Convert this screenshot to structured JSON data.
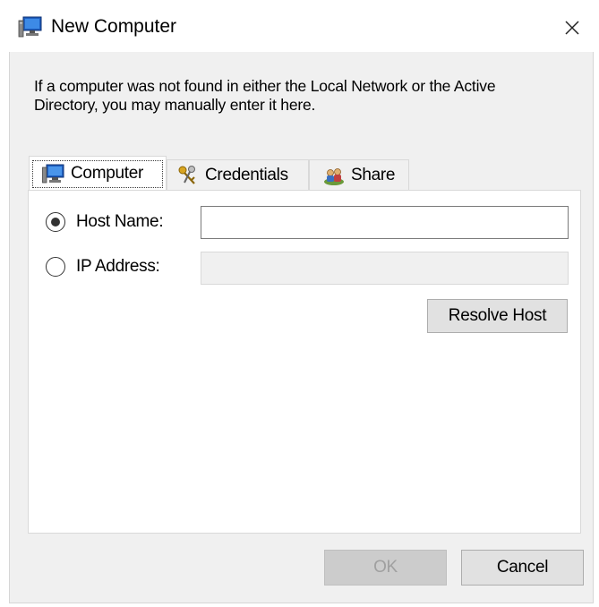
{
  "window": {
    "title": "New Computer",
    "icon": "computer-icon",
    "close_icon": "close-icon"
  },
  "description": "If a computer was not found in either the Local Network or the Active Directory, you may manually enter it here.",
  "tabs": [
    {
      "label": "Computer",
      "icon": "computer-icon",
      "active": true
    },
    {
      "label": "Credentials",
      "icon": "keys-icon",
      "active": false
    },
    {
      "label": "Share",
      "icon": "users-icon",
      "active": false
    }
  ],
  "computer_tab": {
    "host_name_label": "Host Name:",
    "host_name_value": "",
    "host_name_selected": true,
    "ip_address_label": "IP Address:",
    "ip_address_value": "",
    "ip_address_selected": false,
    "resolve_button": "Resolve Host"
  },
  "buttons": {
    "ok": "OK",
    "cancel": "Cancel"
  },
  "colors": {
    "window_bg": "#f0f0f0",
    "panel_bg": "#ffffff",
    "button_bg": "#e1e1e1",
    "disabled_button_bg": "#cccccc"
  }
}
